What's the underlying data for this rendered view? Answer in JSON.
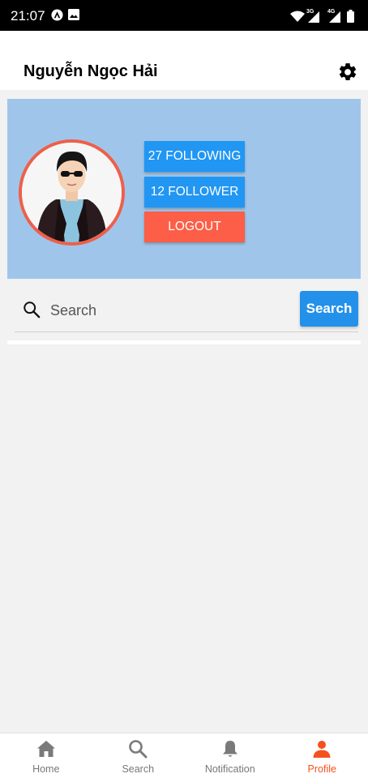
{
  "status_bar": {
    "time": "21:07",
    "net_3g": "3G",
    "net_4g": "4G"
  },
  "header": {
    "name": "Nguyễn Ngọc Hải"
  },
  "profile": {
    "following_label": "27 FOLLOWING",
    "follower_label": "12 FOLLOWER",
    "logout_label": "LOGOUT"
  },
  "search": {
    "placeholder": "Search",
    "button_label": "Search"
  },
  "nav": {
    "items": [
      {
        "label": "Home",
        "icon": "home-icon"
      },
      {
        "label": "Search",
        "icon": "search-icon"
      },
      {
        "label": "Notification",
        "icon": "bell-icon"
      },
      {
        "label": "Profile",
        "icon": "person-icon"
      }
    ],
    "active_index": 3
  },
  "colors": {
    "card_bg": "#9fc6ea",
    "primary": "#2196f3",
    "logout": "#fd5e47",
    "accent": "#f4511e"
  }
}
